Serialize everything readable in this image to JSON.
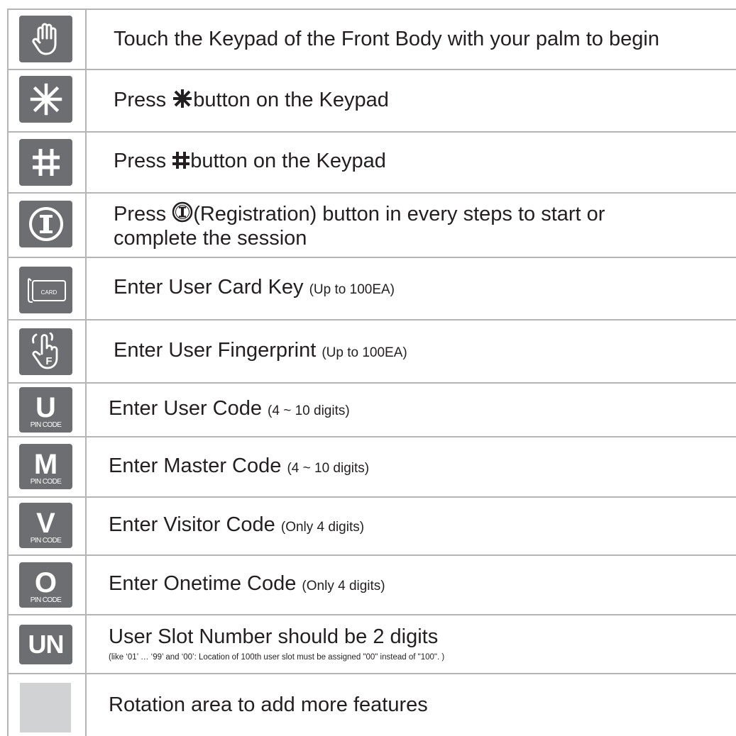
{
  "rows": [
    {
      "icon": "palm-hand-icon",
      "main": "Touch the Keypad of the Front Body with your palm to begin"
    },
    {
      "icon": "asterisk-icon",
      "pre": "Press ",
      "post": "button on the Keypad"
    },
    {
      "icon": "hash-icon",
      "pre": "Press ",
      "post": "button on the Keypad"
    },
    {
      "icon": "registration-icon",
      "pre": "Press ",
      "post": "(Registration) button in every steps to start or",
      "line2": "complete the session"
    },
    {
      "icon": "card-icon",
      "icon_label": "CARD",
      "main": "Enter User Card Key ",
      "note": "(Up to 100EA)"
    },
    {
      "icon": "fingerprint-hand-icon",
      "icon_label": "F",
      "main": "Enter User Fingerprint ",
      "note": "(Up to 100EA)"
    },
    {
      "icon": "pin-code-icon",
      "icon_letter": "U",
      "icon_label": "PIN CODE",
      "main": "Enter User Code ",
      "note": "(4 ~ 10 digits)"
    },
    {
      "icon": "pin-code-icon",
      "icon_letter": "M",
      "icon_label": "PIN CODE",
      "main": "Enter Master Code ",
      "note": "(4 ~ 10 digits)"
    },
    {
      "icon": "pin-code-icon",
      "icon_letter": "V",
      "icon_label": "PIN CODE",
      "main": "Enter Visitor Code ",
      "note": "(Only 4 digits)"
    },
    {
      "icon": "pin-code-icon",
      "icon_letter": "O",
      "icon_label": "PIN CODE",
      "main": "Enter Onetime Code ",
      "note": "(Only 4 digits)"
    },
    {
      "icon": "user-slot-icon",
      "icon_letter": "UN",
      "main": "User Slot Number should be 2 digits",
      "small": "(like ‘01’ … ‘99’ and ‘00’: Location of 100th user slot must be assigned \"00\" instead of \"100\". )"
    },
    {
      "icon": "blank-area-icon",
      "main": "Rotation area to add more features"
    }
  ],
  "colors": {
    "icon_bg": "#6d6e71",
    "blank_bg": "#d1d2d4",
    "rule": "#b5b5b5",
    "text": "#231f20"
  }
}
